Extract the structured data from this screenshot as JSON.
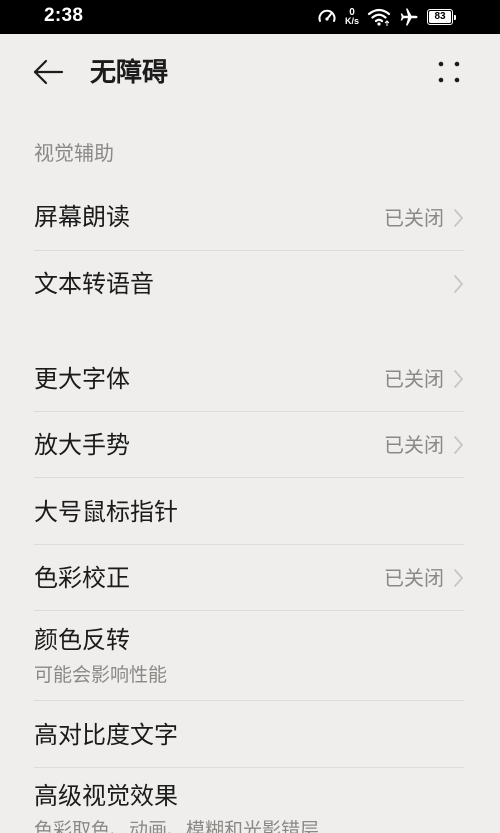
{
  "status_bar": {
    "time": "2:38",
    "net_speed_value": "0",
    "net_speed_unit": "K/s",
    "battery_level": "83",
    "icons": [
      "speedometer-icon",
      "wifi-icon",
      "airplane-icon",
      "battery-icon"
    ]
  },
  "header": {
    "title": "无障碍",
    "back_icon": "arrow-left-icon",
    "more_icon": "more-dots-icon"
  },
  "sections": [
    {
      "title": "视觉辅助",
      "items": [
        {
          "label": "屏幕朗读",
          "status": "已关闭",
          "has_chevron": true
        },
        {
          "label": "文本转语音",
          "status": "",
          "has_chevron": true
        }
      ]
    },
    {
      "title": "",
      "items": [
        {
          "label": "更大字体",
          "status": "已关闭",
          "has_chevron": true
        },
        {
          "label": "放大手势",
          "status": "已关闭",
          "has_chevron": true
        },
        {
          "label": "大号鼠标指针",
          "status": "",
          "has_chevron": false
        },
        {
          "label": "色彩校正",
          "status": "已关闭",
          "has_chevron": true
        },
        {
          "label": "颜色反转",
          "subtitle": "可能会影响性能",
          "has_chevron": false
        },
        {
          "label": "高对比度文字",
          "status": "",
          "has_chevron": false
        },
        {
          "label": "高级视觉效果",
          "subtitle": "色彩取色、动画、模糊和光影错层",
          "has_chevron": false
        }
      ]
    }
  ],
  "colors": {
    "background": "#efeeec",
    "primary_text": "#1b1b1b",
    "secondary_text": "#8b8986",
    "divider": "#dddcd9",
    "status_bar": "#000000"
  }
}
